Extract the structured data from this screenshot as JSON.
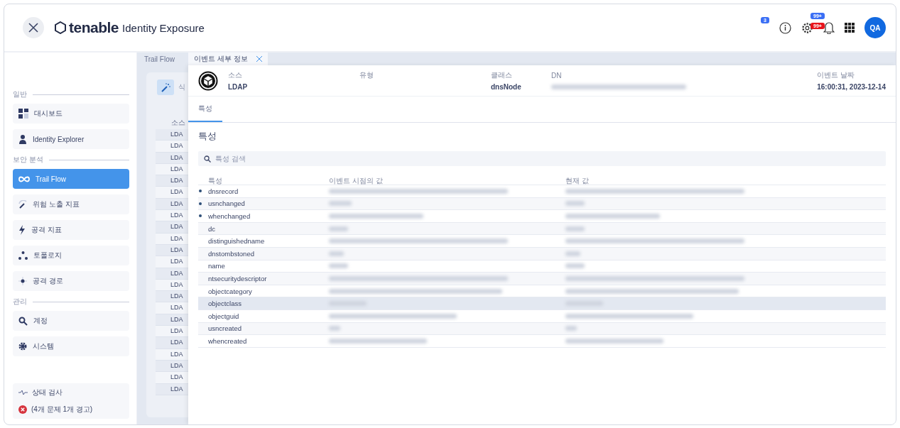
{
  "header": {
    "brand": "tenable",
    "product": "Identity Exposure",
    "info_badge": "3",
    "bell_badges": [
      {
        "text": "99+",
        "color": "#3b6ff5"
      },
      {
        "text": "99+",
        "color": "#e8141b"
      }
    ],
    "avatar": "QA"
  },
  "sidebar": {
    "sections": [
      {
        "label": "일반",
        "items": [
          {
            "label": "대시보드",
            "selected": false
          },
          {
            "label": "Identity Explorer",
            "selected": false
          }
        ]
      },
      {
        "label": "보안 분석",
        "items": [
          {
            "label": "Trail Flow",
            "selected": true
          },
          {
            "label": "위험 노출 지표",
            "selected": false
          },
          {
            "label": "공격 지표",
            "selected": false
          },
          {
            "label": "토폴로지",
            "selected": false
          },
          {
            "label": "공격 경로",
            "selected": false
          }
        ]
      },
      {
        "label": "관리",
        "items": [
          {
            "label": "계정",
            "selected": false
          },
          {
            "label": "시스템",
            "selected": false
          }
        ]
      }
    ],
    "health": {
      "title": "상태 검사",
      "status": "(4개 문제 1개 경고)"
    }
  },
  "tabs": [
    {
      "label": "Trail Flow",
      "selected": false,
      "closable": false
    },
    {
      "label": "이벤트 세부 정보",
      "selected": true,
      "closable": true
    }
  ],
  "background_table": {
    "search_text": "식",
    "column": "소스",
    "rows": [
      "LDA",
      "LDA",
      "LDA",
      "LDA",
      "LDA",
      "LDA",
      "LDA",
      "LDA",
      "LDA",
      "LDA",
      "LDA",
      "LDA",
      "LDA",
      "LDA",
      "LDA",
      "LDA",
      "LDA",
      "LDA",
      "LDA",
      "LDA",
      "LDA",
      "LDA",
      "LDA"
    ]
  },
  "event": {
    "fields": [
      {
        "label": "소스",
        "value": "LDAP"
      },
      {
        "label": "유형"
      },
      {
        "label": "클래스",
        "value": "dnsNode"
      },
      {
        "label": "DN",
        "redacted": true
      },
      {
        "label": "이벤트 날짜",
        "value": "16:00:31, 2023-12-14"
      }
    ],
    "subtabs": [
      {
        "label": "특성",
        "selected": true
      }
    ],
    "section_title": "특성",
    "search": {
      "placeholder": "특성 검색"
    },
    "columns": [
      "특성",
      "이벤트 시점의 값",
      "현재 값"
    ],
    "rows": [
      {
        "name": "dnsrecord",
        "changed": true,
        "highlighted": false
      },
      {
        "name": "usnchanged",
        "changed": true,
        "highlighted": false
      },
      {
        "name": "whenchanged",
        "changed": true,
        "highlighted": false
      },
      {
        "name": "dc",
        "changed": false,
        "highlighted": false
      },
      {
        "name": "distinguishedname",
        "changed": false,
        "highlighted": false
      },
      {
        "name": "dnstombstoned",
        "changed": false,
        "highlighted": false
      },
      {
        "name": "name",
        "changed": false,
        "highlighted": false
      },
      {
        "name": "ntsecuritydescriptor",
        "changed": false,
        "highlighted": false
      },
      {
        "name": "objectcategory",
        "changed": false,
        "highlighted": false
      },
      {
        "name": "objectclass",
        "changed": false,
        "highlighted": true
      },
      {
        "name": "objectguid",
        "changed": false,
        "highlighted": false
      },
      {
        "name": "usncreated",
        "changed": false,
        "highlighted": false
      },
      {
        "name": "whencreated",
        "changed": false,
        "highlighted": false
      }
    ]
  }
}
